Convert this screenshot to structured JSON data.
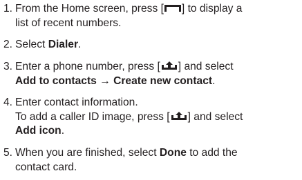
{
  "steps": [
    {
      "number": "1.",
      "line1_a": "From the Home screen, press [",
      "line1_b": "] to display a",
      "line2": "list of recent numbers.",
      "key_icon": "back-key-icon"
    },
    {
      "number": "2.",
      "text_a": "Select ",
      "bold": "Dialer",
      "text_b": "."
    },
    {
      "number": "3.",
      "line1_a": "Enter a phone number, press [",
      "line1_b": "] and select",
      "bold": "Add to contacts → Create new contact",
      "line2_end": ".",
      "key_icon": "menu-key-icon"
    },
    {
      "number": "4.",
      "line1": "Enter contact information.",
      "line2_a": "To add a caller ID image, press [",
      "line2_b": "] and select",
      "bold": "Add icon",
      "line3_end": ".",
      "key_icon": "menu-key-icon"
    },
    {
      "number": "5.",
      "line1_a": "When you are finished, select ",
      "bold": "Done",
      "line1_b": " to add the",
      "line2": "contact card."
    }
  ]
}
